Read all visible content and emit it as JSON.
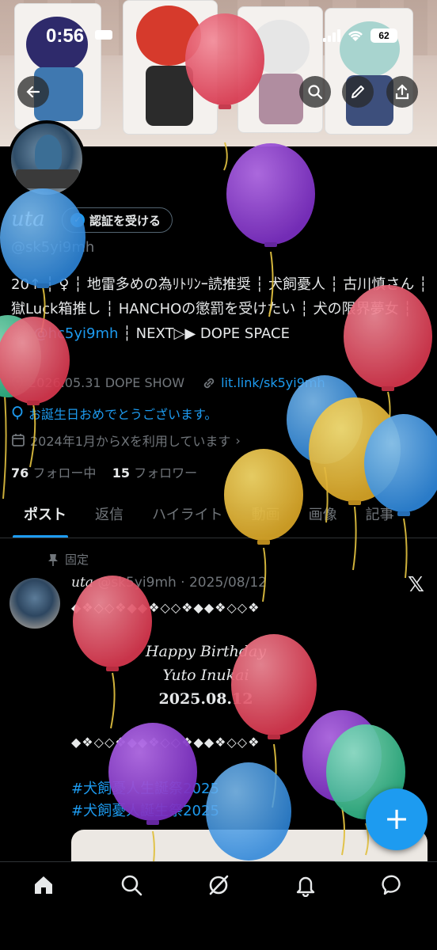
{
  "status_bar": {
    "time": "0:56",
    "battery": "62"
  },
  "header": {
    "back_icon": "arrow-left-icon",
    "search_icon": "search-icon",
    "edit_icon": "pencil-icon",
    "share_icon": "share-icon"
  },
  "profile": {
    "display_name": "uta",
    "verify_button_label": "認証を受ける",
    "handle": "@sk5yi9mh",
    "bio_part1": "20↑ ┆ ♀ ┆ 地雷多めの為ﾘﾄﾘﾝｰ読推奨 ┆ 犬飼憂人 ┆ 古川慎さん ┆ 獄Luck箱推し ┆ HANCHOの懲罰を受けたい ┆ 犬の限界夢女 ┆ 🗝 ",
    "bio_link": "@hc5yi9mh",
    "bio_part2": " ┆ NEXT▷▶ DOPE SPACE",
    "location": "2026.05.31 DOPE SHOW",
    "website": "lit.link/sk5yi9mh",
    "birthday": "お誕生日おめでとうございます。",
    "joined": "2024年1月からXを利用しています",
    "following_count": "76",
    "following_label": "フォロー中",
    "followers_count": "15",
    "followers_label": "フォロワー"
  },
  "tabs": [
    {
      "label": "ポスト"
    },
    {
      "label": "返信"
    },
    {
      "label": "ハイライト"
    },
    {
      "label": "動画"
    },
    {
      "label": "画像"
    },
    {
      "label": "記事"
    }
  ],
  "post": {
    "pinned_label": "固定",
    "author": "uta",
    "handle_date": "@sk5yi9mh · 2025/08/12",
    "deco_top": "◆❖◇◇❖◆◆❖◇◇❖◆◆❖◇◇❖",
    "line1": "Happy Birthday",
    "line2": "Yuto Inukai",
    "line3": "2025.08.12",
    "deco_bottom": "◆❖◇◇❖◆◆❖◇◇❖◆◆❖◇◇❖",
    "hashtag1": "#犬飼憂人生誕祭2025",
    "hashtag2": "#犬飼憂人誕生祭2025",
    "x_logo": "𝕏"
  },
  "fab_label": "+",
  "nav": [
    "home-icon",
    "search-icon",
    "grok-icon",
    "bell-icon",
    "message-icon"
  ]
}
